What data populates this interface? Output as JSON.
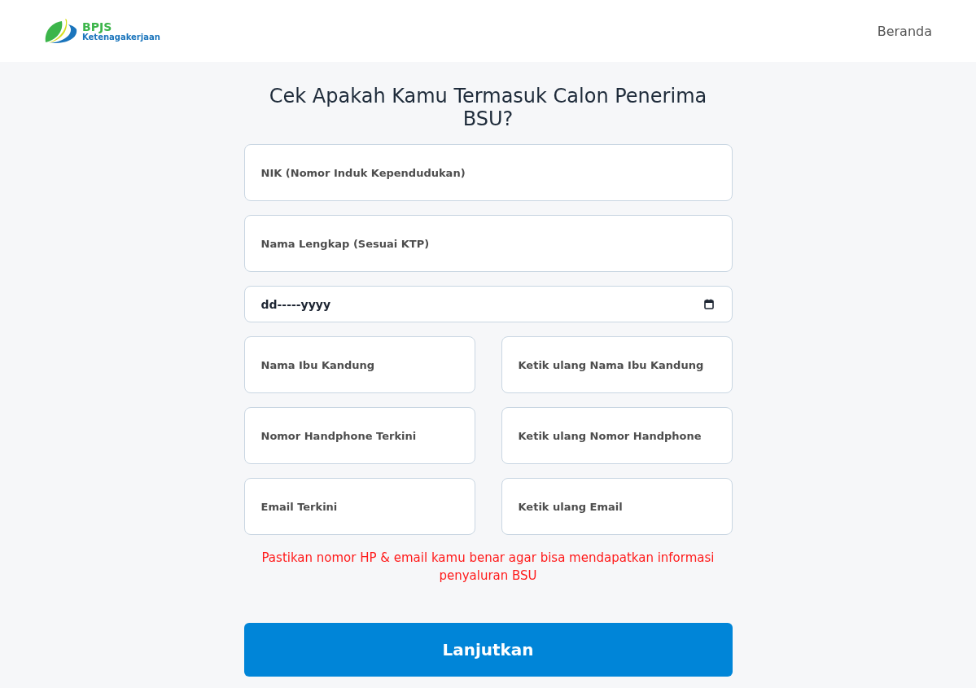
{
  "header": {
    "logo": {
      "name": "BPJS",
      "subtitle": "Ketenagakerjaan"
    },
    "nav": [
      {
        "label": "Beranda"
      }
    ]
  },
  "form": {
    "title": "Cek Apakah Kamu Termasuk Calon Penerima BSU?",
    "rows": [
      {
        "fields": [
          {
            "kind": "text",
            "placeholder": "NIK (Nomor Induk Kependudukan)"
          }
        ]
      },
      {
        "fields": [
          {
            "kind": "text",
            "placeholder": "Nama Lengkap (Sesuai KTP)"
          }
        ]
      },
      {
        "fields": [
          {
            "kind": "date",
            "value": "dd-----yyyy"
          }
        ]
      },
      {
        "fields": [
          {
            "kind": "text",
            "placeholder": "Nama Ibu Kandung"
          },
          {
            "kind": "text",
            "placeholder": "Ketik ulang Nama Ibu Kandung"
          }
        ]
      },
      {
        "fields": [
          {
            "kind": "text",
            "placeholder": "Nomor Handphone Terkini"
          },
          {
            "kind": "text",
            "placeholder": "Ketik ulang Nomor Handphone"
          }
        ]
      },
      {
        "fields": [
          {
            "kind": "text",
            "placeholder": "Email Terkini"
          },
          {
            "kind": "text",
            "placeholder": "Ketik ulang Email"
          }
        ]
      }
    ],
    "notice": "Pastikan nomor HP & email kamu benar agar bisa mendapatkan informasi penyaluran BSU",
    "submit_button": "Lanjutkan"
  }
}
